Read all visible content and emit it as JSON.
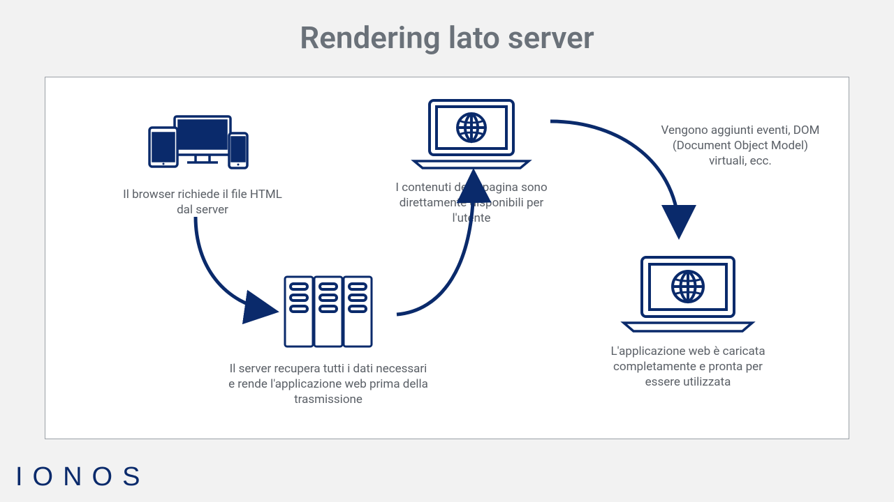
{
  "title": "Rendering lato server",
  "logo": "IONOS",
  "steps": {
    "browser": "Il browser richiede il file HTML dal server",
    "server": "Il server recupera tutti i dati necessari e rende l'applicazione web prima della trasmissione",
    "content": "I contenuti della pagina sono direttamente disponibili per l'utente",
    "events": "Vengono aggiunti eventi, DOM (Document Object Model) virtuali, ecc.",
    "loaded": "L'applicazione web è caricata completamente e pronta per essere utilizzata"
  }
}
